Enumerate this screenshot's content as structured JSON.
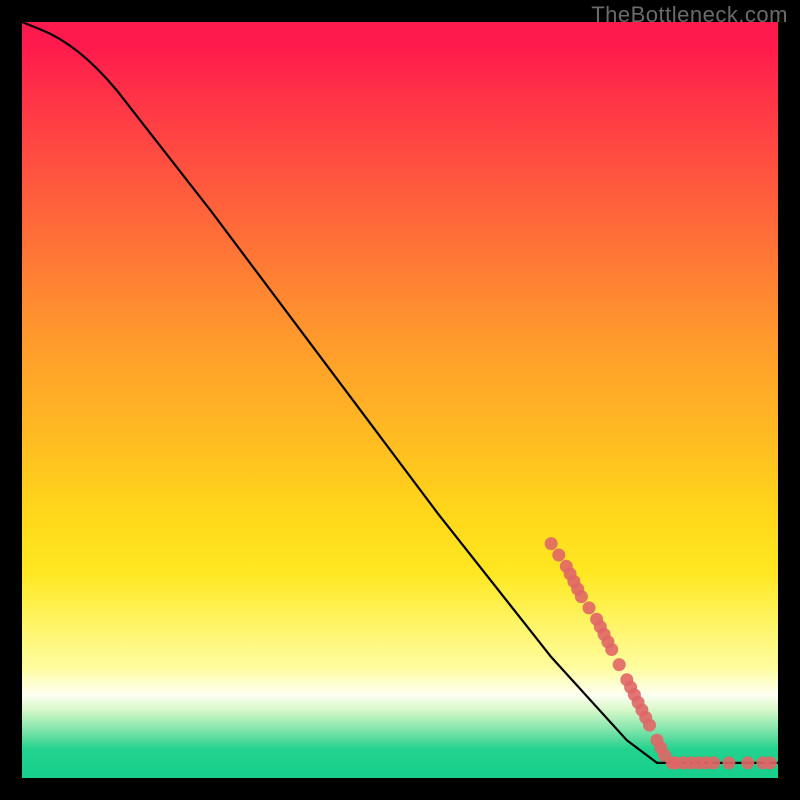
{
  "watermark": "TheBottleneck.com",
  "chart_data": {
    "type": "line",
    "title": "",
    "xlabel": "",
    "ylabel": "",
    "xlim": [
      0,
      100
    ],
    "ylim": [
      0,
      100
    ],
    "grid": false,
    "curve": [
      {
        "x": 0.0,
        "y": 100.0
      },
      {
        "x": 5.0,
        "y": 98.0
      },
      {
        "x": 10.0,
        "y": 94.0
      },
      {
        "x": 15.0,
        "y": 88.0
      },
      {
        "x": 25.0,
        "y": 75.0
      },
      {
        "x": 40.0,
        "y": 55.0
      },
      {
        "x": 55.0,
        "y": 35.0
      },
      {
        "x": 70.0,
        "y": 16.0
      },
      {
        "x": 80.0,
        "y": 5.0
      },
      {
        "x": 84.0,
        "y": 2.0
      },
      {
        "x": 100.0,
        "y": 2.0
      }
    ],
    "markers": [
      {
        "x": 70.0,
        "y": 31.0
      },
      {
        "x": 71.0,
        "y": 29.5
      },
      {
        "x": 72.0,
        "y": 28.0
      },
      {
        "x": 72.5,
        "y": 27.0
      },
      {
        "x": 73.0,
        "y": 26.0
      },
      {
        "x": 73.5,
        "y": 25.0
      },
      {
        "x": 74.0,
        "y": 24.0
      },
      {
        "x": 75.0,
        "y": 22.5
      },
      {
        "x": 76.0,
        "y": 21.0
      },
      {
        "x": 76.5,
        "y": 20.0
      },
      {
        "x": 77.0,
        "y": 19.0
      },
      {
        "x": 77.5,
        "y": 18.0
      },
      {
        "x": 78.0,
        "y": 17.0
      },
      {
        "x": 79.0,
        "y": 15.0
      },
      {
        "x": 80.0,
        "y": 13.0
      },
      {
        "x": 80.5,
        "y": 12.0
      },
      {
        "x": 81.0,
        "y": 11.0
      },
      {
        "x": 81.5,
        "y": 10.0
      },
      {
        "x": 82.0,
        "y": 9.0
      },
      {
        "x": 82.5,
        "y": 8.0
      },
      {
        "x": 83.0,
        "y": 7.0
      },
      {
        "x": 84.0,
        "y": 5.0
      },
      {
        "x": 84.5,
        "y": 4.0
      },
      {
        "x": 85.0,
        "y": 3.0
      },
      {
        "x": 86.0,
        "y": 2.0
      },
      {
        "x": 86.5,
        "y": 2.0
      },
      {
        "x": 87.5,
        "y": 2.0
      },
      {
        "x": 88.5,
        "y": 2.0
      },
      {
        "x": 89.5,
        "y": 2.0
      },
      {
        "x": 90.5,
        "y": 2.0
      },
      {
        "x": 91.5,
        "y": 2.0
      },
      {
        "x": 93.5,
        "y": 2.0
      },
      {
        "x": 96.0,
        "y": 2.0
      },
      {
        "x": 98.0,
        "y": 2.0
      },
      {
        "x": 99.0,
        "y": 2.0
      }
    ],
    "marker_color": "#e06666",
    "line_color": "#000000",
    "background_gradient": {
      "top": "#ff1a4d",
      "mid": "#ffd71a",
      "bottom": "#15cf8a"
    }
  }
}
